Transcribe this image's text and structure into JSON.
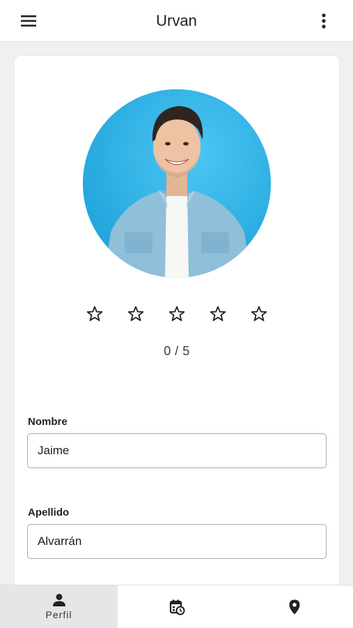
{
  "app_bar": {
    "title": "Urvan",
    "menu_icon": "hamburger-menu-icon",
    "more_icon": "more-vertical-icon"
  },
  "profile": {
    "avatar": "profile-photo",
    "rating": {
      "value": 0,
      "max": 5,
      "text": "0 / 5",
      "star_icon": "star-outline-icon"
    },
    "fields": [
      {
        "label": "Nombre",
        "value": "Jaime"
      },
      {
        "label": "Apellido",
        "value": "Alvarrán"
      }
    ]
  },
  "bottom_nav": {
    "items": [
      {
        "label": "Perfil",
        "icon": "person-icon",
        "active": true
      },
      {
        "label": "",
        "icon": "calendar-clock-icon",
        "active": false
      },
      {
        "label": "",
        "icon": "location-pin-icon",
        "active": false
      }
    ]
  },
  "colors": {
    "background": "#eff0f2",
    "avatar_bg": "#31b4ea",
    "active_tab": "#e6e6e8"
  }
}
